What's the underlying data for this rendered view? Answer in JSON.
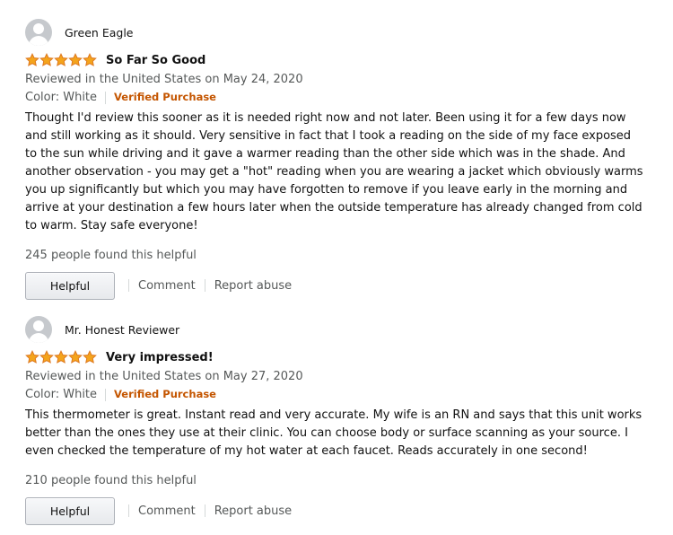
{
  "reviews": [
    {
      "profile_name": "Green Eagle",
      "rating": 5,
      "title": "So Far So Good",
      "date": "Reviewed in the United States on May 24, 2020",
      "format": "Color: White",
      "verified": "Verified Purchase",
      "body": "Thought I'd review this sooner as it is needed right now and not later. Been using it for a few days now and still working as it should. Very sensitive in fact that I took a reading on the side of my face exposed to the sun while driving and it gave a warmer reading than the other side which was in the shade. And another observation - you may get a \"hot\" reading when you are wearing a jacket which obviously warms you up significantly but which you may have forgotten to remove if you leave early in the morning and arrive at your destination a few hours later when the outside temperature has already changed from cold to warm. Stay safe everyone!",
      "helpful_count": "245 people found this helpful"
    },
    {
      "profile_name": "Mr. Honest Reviewer",
      "rating": 5,
      "title": "Very impressed!",
      "date": "Reviewed in the United States on May 27, 2020",
      "format": "Color: White",
      "verified": "Verified Purchase",
      "body": "This thermometer is great. Instant read and very accurate. My wife is an RN and says that this unit works better than the ones they use at their clinic. You can choose body or surface scanning as your source. I even checked the temperature of my hot water at each faucet. Reads accurately in one second!",
      "helpful_count": "210 people found this helpful"
    }
  ],
  "actions": {
    "helpful": "Helpful",
    "comment": "Comment",
    "report": "Report abuse"
  },
  "colors": {
    "star": "#f4a41c",
    "verified": "#c45500",
    "secondary_text": "#565959"
  }
}
